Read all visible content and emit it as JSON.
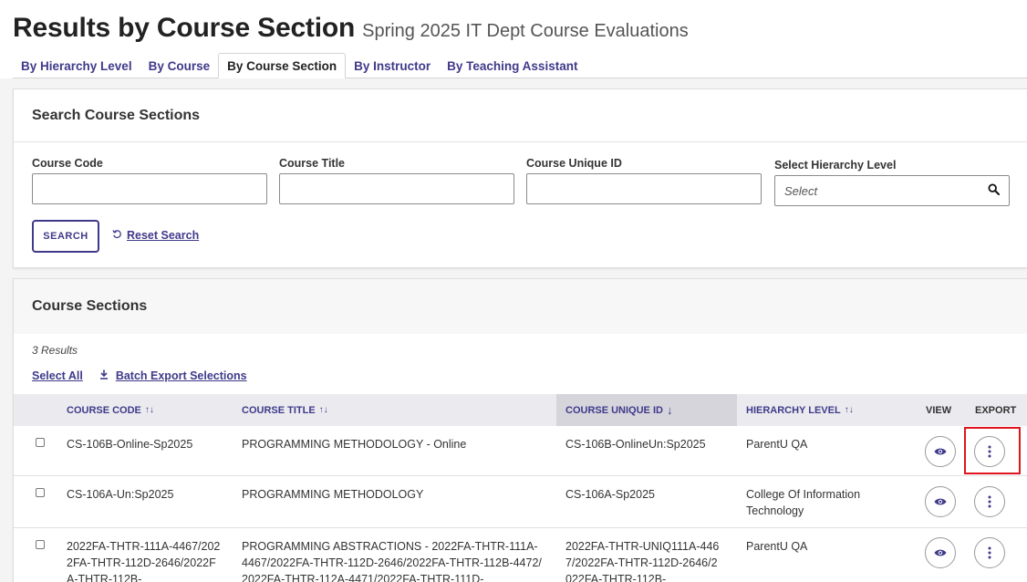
{
  "header": {
    "title": "Results by Course Section",
    "subtitle": "Spring 2025 IT Dept Course Evaluations"
  },
  "tabs": [
    {
      "label": "By Hierarchy Level",
      "active": false
    },
    {
      "label": "By Course",
      "active": false
    },
    {
      "label": "By Course Section",
      "active": true
    },
    {
      "label": "By Instructor",
      "active": false
    },
    {
      "label": "By Teaching Assistant",
      "active": false
    }
  ],
  "search": {
    "title": "Search Course Sections",
    "fields": {
      "course_code": {
        "label": "Course Code",
        "value": ""
      },
      "course_title": {
        "label": "Course Title",
        "value": ""
      },
      "course_unique_id": {
        "label": "Course Unique ID",
        "value": ""
      },
      "hierarchy_level": {
        "label": "Select Hierarchy Level",
        "placeholder": "Select"
      }
    },
    "search_button": "SEARCH",
    "reset_link": "Reset Search"
  },
  "results": {
    "title": "Course Sections",
    "count_text": "3 Results",
    "select_all": "Select All",
    "batch_export": "Batch Export Selections",
    "columns": {
      "course_code": "COURSE CODE",
      "course_title": "COURSE TITLE",
      "course_unique_id": "COURSE UNIQUE ID",
      "hierarchy_level": "HIERARCHY LEVEL",
      "view": "VIEW",
      "export": "EXPORT"
    },
    "sorted_column": "course_unique_id",
    "sort_direction": "descending",
    "rows": [
      {
        "course_code": "CS-106B-Online-Sp2025",
        "course_title": "PROGRAMMING METHODOLOGY - Online",
        "course_unique_id": "CS-106B-OnlineUn:Sp2025",
        "hierarchy_level": "ParentU QA"
      },
      {
        "course_code": "CS-106A-Un:Sp2025",
        "course_title": "PROGRAMMING METHODOLOGY",
        "course_unique_id": "CS-106A-Sp2025",
        "hierarchy_level": "College Of Information Technology"
      },
      {
        "course_code": "2022FA-THTR-111A-4467/2022FA-THTR-112D-2646/2022FA-THTR-112B-",
        "course_title": "PROGRAMMING ABSTRACTIONS - 2022FA-THTR-111A-4467/2022FA-THTR-112D-2646/2022FA-THTR-112B-4472/2022FA-THTR-112A-4471/2022FA-THTR-111D-",
        "course_unique_id": "2022FA-THTR-UNIQ111A-4467/2022FA-THTR-112D-2646/2022FA-THTR-112B-",
        "hierarchy_level": "ParentU QA"
      }
    ]
  },
  "colors": {
    "accent": "#3f3a8a",
    "highlight": "#e0141e",
    "table_header_bg": "#ebebef",
    "sorted_header_bg": "#d6d5dc"
  },
  "icons": {
    "select_search": "search-icon",
    "reset": "reset-icon",
    "batch_export": "download-icon",
    "view": "eye-icon",
    "export": "more-vertical-icon"
  }
}
